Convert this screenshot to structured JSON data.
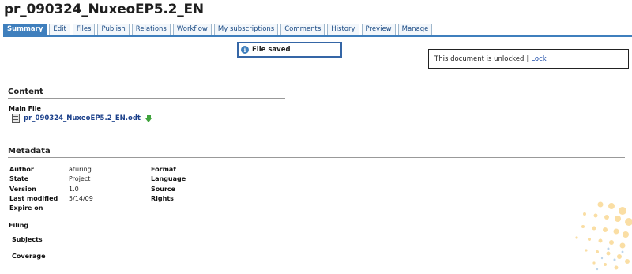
{
  "document": {
    "title": "pr_090324_NuxeoEP5.2_EN"
  },
  "tabs": [
    {
      "label": "Summary",
      "active": true
    },
    {
      "label": "Edit"
    },
    {
      "label": "Files"
    },
    {
      "label": "Publish"
    },
    {
      "label": "Relations"
    },
    {
      "label": "Workflow"
    },
    {
      "label": "My subscriptions"
    },
    {
      "label": "Comments"
    },
    {
      "label": "History"
    },
    {
      "label": "Preview"
    },
    {
      "label": "Manage"
    }
  ],
  "message": {
    "icon": "info-icon",
    "text": "File saved"
  },
  "lock": {
    "status_text": "This document is unlocked",
    "separator": "|",
    "action": "Lock"
  },
  "content": {
    "heading": "Content",
    "main_file_label": "Main File",
    "file_name": "pr_090324_NuxeoEP5.2_EN.odt"
  },
  "metadata": {
    "heading": "Metadata",
    "left_labels": {
      "author": "Author",
      "state": "State",
      "version": "Version",
      "last_modified": "Last modified",
      "expire_on": "Expire on"
    },
    "left_values": {
      "author": "aturing",
      "state": "Project",
      "version": "1.0",
      "last_modified": "5/14/09"
    },
    "right_labels": {
      "format": "Format",
      "language": "Language",
      "source": "Source",
      "rights": "Rights"
    }
  },
  "filing": {
    "heading": "Filing",
    "subjects": "Subjects",
    "coverage": "Coverage"
  },
  "colors": {
    "accent": "#3f7fbd",
    "link": "#1a4aa8",
    "decoration": "#f6c45a"
  }
}
